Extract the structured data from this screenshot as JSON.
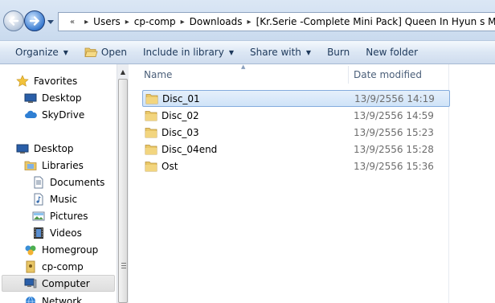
{
  "address": {
    "overflow": "«",
    "crumbs": [
      "Users",
      "cp-comp",
      "Downloads",
      "[Kr.Serie -Complete Mini Pack] Queen In Hyun s Man"
    ]
  },
  "toolbar": {
    "organize": "Organize",
    "open": "Open",
    "include_in_library": "Include in library",
    "share_with": "Share with",
    "burn": "Burn",
    "new_folder": "New folder"
  },
  "nav": {
    "favorites": "Favorites",
    "desktop_fav": "Desktop",
    "skydrive": "SkyDrive",
    "desktop": "Desktop",
    "libraries": "Libraries",
    "documents": "Documents",
    "music": "Music",
    "pictures": "Pictures",
    "videos": "Videos",
    "homegroup": "Homegroup",
    "cp_comp": "cp-comp",
    "computer": "Computer",
    "network": "Network"
  },
  "columns": {
    "name": "Name",
    "date_modified": "Date modified"
  },
  "files": [
    {
      "name": "Disc_01",
      "date": "13/9/2556 14:19",
      "selected": true
    },
    {
      "name": "Disc_02",
      "date": "13/9/2556 14:59",
      "selected": false
    },
    {
      "name": "Disc_03",
      "date": "13/9/2556 15:23",
      "selected": false
    },
    {
      "name": "Disc_04end",
      "date": "13/9/2556 15:28",
      "selected": false
    },
    {
      "name": "Ost",
      "date": "13/9/2556 15:36",
      "selected": false
    }
  ],
  "colors": {
    "selection": "#cfe3f8",
    "toolbar": "#dce7f4",
    "folder": "#e8c25a"
  }
}
